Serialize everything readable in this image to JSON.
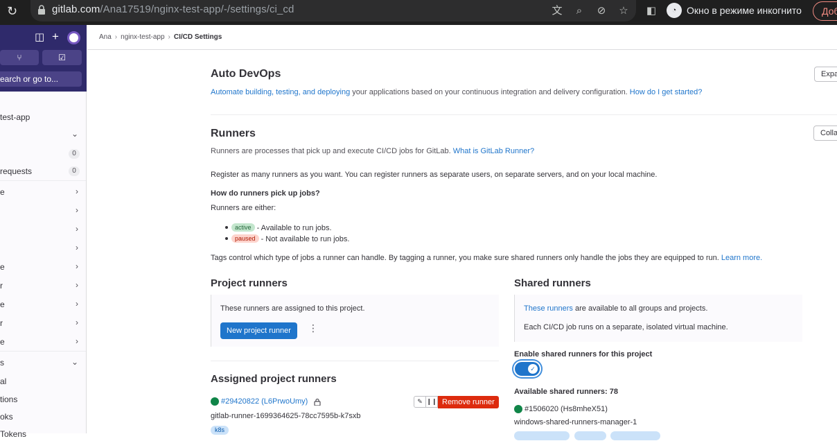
{
  "browser": {
    "url_host": "gitlab.com",
    "url_path": "/Ana17519/nginx-test-app/-/settings/ci_cd",
    "incognito_label": "Окно в режиме инкогнито",
    "action_label": "Доб"
  },
  "sidebar": {
    "search_label": "earch or go to...",
    "project_name": "test-app",
    "items": [
      {
        "label": "",
        "count": "0"
      },
      {
        "label": "requests",
        "count": "0"
      },
      {
        "label": "e"
      },
      {
        "label": ""
      },
      {
        "label": ""
      },
      {
        "label": ""
      },
      {
        "label": "e"
      },
      {
        "label": "r"
      },
      {
        "label": "e"
      },
      {
        "label": "r"
      },
      {
        "label": "e"
      },
      {
        "label": "s"
      },
      {
        "label": "al"
      },
      {
        "label": "tions"
      },
      {
        "label": "oks"
      },
      {
        "label": "Tokens"
      }
    ]
  },
  "breadcrumb": {
    "items": [
      "Ana",
      "nginx-test-app"
    ],
    "current": "CI/CD Settings"
  },
  "auto_devops": {
    "title": "Auto DevOps",
    "link_text": "Automate building, testing, and deploying",
    "desc": " your applications based on your continuous integration and delivery configuration. ",
    "help_link": "How do I get started?",
    "button": "Expand"
  },
  "runners": {
    "title": "Runners",
    "desc": "Runners are processes that pick up and execute CI/CD jobs for GitLab. ",
    "what_link": "What is GitLab Runner?",
    "button": "Collapse",
    "register_text": "Register as many runners as you want. You can register runners as separate users, on separate servers, and on your local machine.",
    "how_title": "How do runners pick up jobs?",
    "either": "Runners are either:",
    "active_badge": "active",
    "active_text": " - Available to run jobs.",
    "paused_badge": "paused",
    "paused_text": " - Not available to run jobs.",
    "tags_text": "Tags control which type of jobs a runner can handle. By tagging a runner, you make sure shared runners only handle the jobs they are equipped to run. ",
    "learn_more": "Learn more."
  },
  "project_runners": {
    "title": "Project runners",
    "panel_text": "These runners are assigned to this project.",
    "new_button": "New project runner",
    "assigned_title": "Assigned project runners",
    "runner_id": "#29420822 (L6PrwoUmy)",
    "runner_desc": "gitlab-runner-1699364625-78cc7595b-k7sxb",
    "runner_tag": "k8s",
    "edit_icon": "pencil",
    "pause_icon": "pause",
    "remove_button": "Remove runner"
  },
  "shared_runners": {
    "title": "Shared runners",
    "these_link": "These runners",
    "panel_text1": " are available to all groups and projects.",
    "panel_text2": "Each CI/CD job runs on a separate, isolated virtual machine.",
    "enable_label": "Enable shared runners for this project",
    "enabled": true,
    "available_label": "Available shared runners: 78",
    "runner_id": "#1506020 (Hs8mheX51)",
    "runner_desc": "windows-shared-runners-manager-1"
  },
  "colors": {
    "accent": "#1f75cb",
    "sidebar_top": "#2f2a6b",
    "danger": "#dd2b0e",
    "online": "#108548"
  }
}
